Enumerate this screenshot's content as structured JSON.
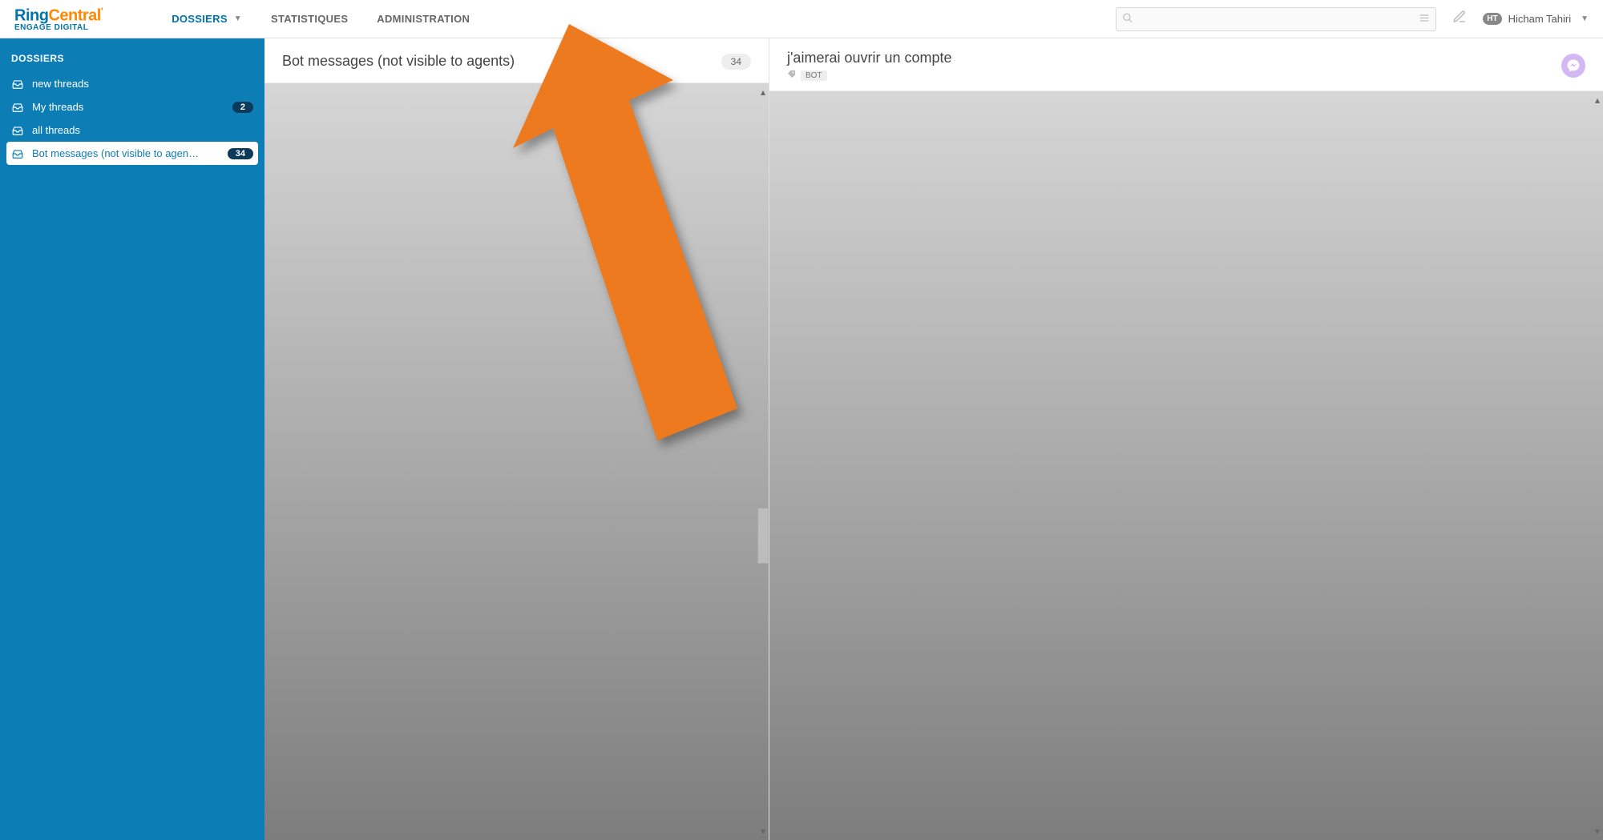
{
  "logo": {
    "brand_a": "Ring",
    "brand_b": "Central",
    "subline": "ENGAGE DIGITAL"
  },
  "nav": {
    "items": [
      {
        "label": "DOSSIERS",
        "active": true,
        "has_caret": true
      },
      {
        "label": "STATISTIQUES",
        "active": false,
        "has_caret": false
      },
      {
        "label": "ADMINISTRATION",
        "active": false,
        "has_caret": false
      }
    ]
  },
  "search": {
    "placeholder": ""
  },
  "user": {
    "initials": "HT",
    "name": "Hicham Tahiri"
  },
  "sidebar": {
    "section_title": "DOSSIERS",
    "items": [
      {
        "label": "new threads",
        "badge": "",
        "selected": false
      },
      {
        "label": "My threads",
        "badge": "2",
        "selected": false
      },
      {
        "label": "all threads",
        "badge": "",
        "selected": false
      },
      {
        "label": "Bot messages (not visible to agen…",
        "badge": "34",
        "selected": true
      }
    ]
  },
  "list_panel": {
    "title": "Bot messages (not visible to agents)",
    "count": "34"
  },
  "detail_panel": {
    "title": "j'aimerai ouvrir un compte",
    "tag": "BOT"
  },
  "annotation": {
    "arrow_color": "#ee7a1f"
  }
}
